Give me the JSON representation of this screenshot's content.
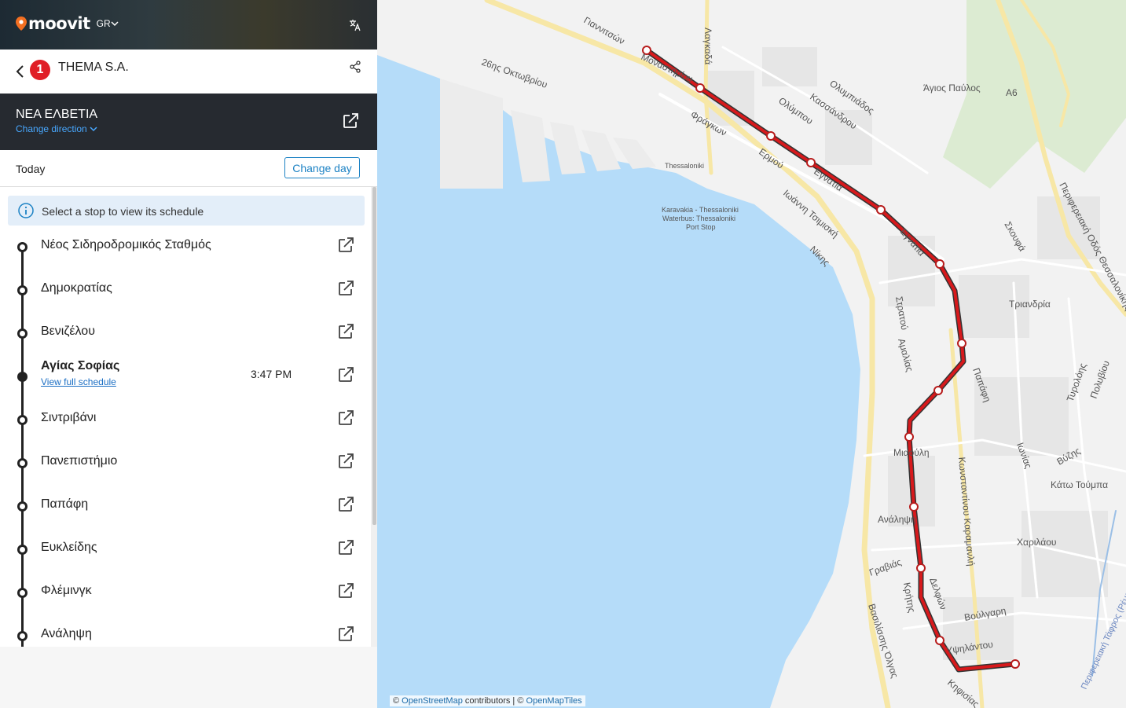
{
  "app": {
    "brand": "moovit",
    "region": "GR",
    "accent": "#f36f21"
  },
  "line": {
    "badge": "1",
    "badge_color": "#e01e26",
    "agency": "THEMA S.A.",
    "direction_title": "ΝΕΑ ΕΛΒΕΤΙΑ",
    "change_direction": "Change direction"
  },
  "day": {
    "label": "Today",
    "change_day": "Change day"
  },
  "info": {
    "text": "Select a stop to view its schedule"
  },
  "stops": [
    {
      "name": "Νέος Σιδηροδρομικός Σταθμός"
    },
    {
      "name": "Δημοκρατίας"
    },
    {
      "name": "Βενιζέλου"
    },
    {
      "name": "Αγίας Σοφίας",
      "link": "View full schedule",
      "time": "3:47 PM",
      "active": true
    },
    {
      "name": "Σιντριβάνι"
    },
    {
      "name": "Πανεπιστήμιο"
    },
    {
      "name": "Παπάφη"
    },
    {
      "name": "Ευκλείδης"
    },
    {
      "name": "Φλέμινγκ"
    },
    {
      "name": "Ανάληψη"
    }
  ],
  "map": {
    "labels": {
      "giannitson": "Γιαννιτσών",
      "lagkada": "Λαγκαδά",
      "oktovriou": "26ης Οκτωβρίου",
      "monastiriou": "Μοναστηρίου",
      "fragkon": "Φράγκων",
      "olympou": "Ολύμπου",
      "kassandrou": "Κασσάνδρου",
      "olympiados": "Ολυμπιάδος",
      "agios_pavlos": "Άγιος Παύλος",
      "a6": "A6",
      "ermou": "Ερμού",
      "egnatia_1": "Εγνατία",
      "egnatia_2": "Εγνατία",
      "thessaloniki": "Thessaloniki",
      "karavakia_1": "Karavakia - Thessaloniki",
      "karavakia_2": "Waterbus: Thessaloniki",
      "karavakia_3": "Port Stop",
      "tsimiski": "Ιωάννη Τσιμισκή",
      "nikis": "Νίκης",
      "skra": "Σκουφά",
      "periferiaki": "Περιφερειακή Οδός Θεσσαλονίκης",
      "triandria": "Τριανδρία",
      "stratou": "Στρατού",
      "amalias": "Αμαλίας",
      "papafi": "Παπάφη",
      "tyrolois": "Τυρολόης",
      "polyviou": "Πολυβίου",
      "miaouli": "Μιαούλη",
      "karamanli": "Κωνσταντίνου Καραμανλή",
      "ionias": "Ιωνίας",
      "vyzis": "Βύζης",
      "kato_toumpa": "Κάτω Τούμπα",
      "analipsi": "Ανάληψη",
      "charilaou": "Χαριλάου",
      "graviias": "Γραβιάς",
      "kritis": "Κρήτης",
      "delfon": "Δελφών",
      "voulgari": "Βούλγαρη",
      "vas_olgas": "Βασιλίσσης Όλγας",
      "ypsilantou": "Υψηλάντου",
      "kifisias": "Κηφισίας",
      "rema": "Περιφερειακή Τάφρος (Ρέμα Τούμπας)"
    },
    "attribution": {
      "prefix": "©",
      "osm": "OpenStreetMap",
      "contributors": "contributors |",
      "copy2": "©",
      "omt": "OpenMapTiles"
    },
    "colors": {
      "sea": "#b5dcf9",
      "land": "#f2f2f2",
      "route": "#d7191c",
      "park": "#dcebd2"
    }
  }
}
